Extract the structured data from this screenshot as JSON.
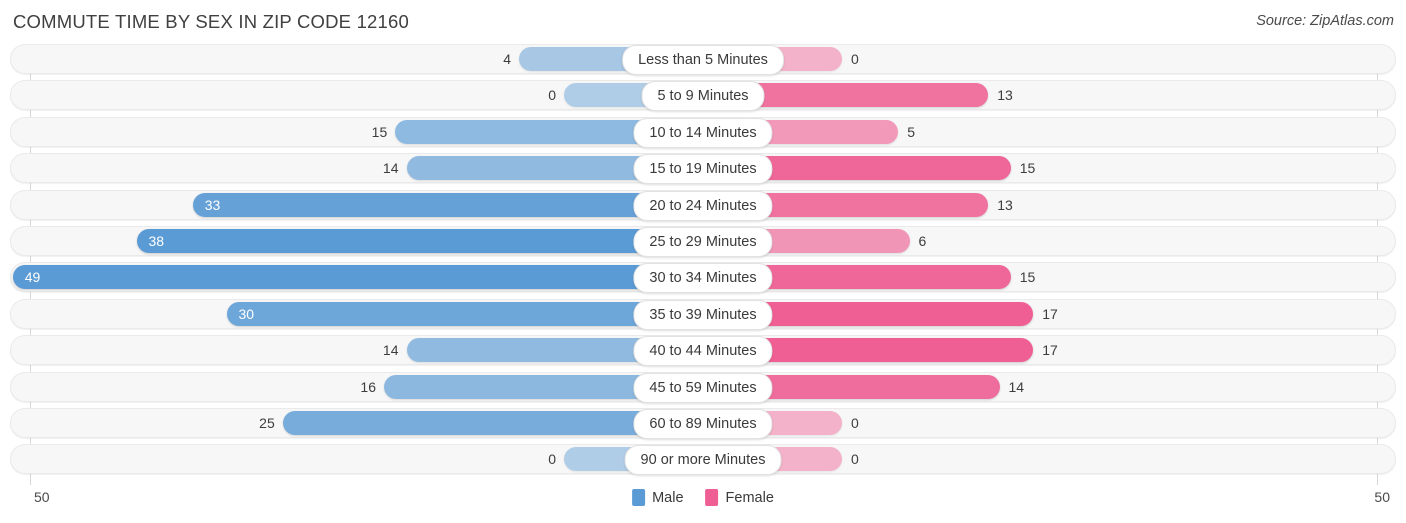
{
  "header": {
    "title": "COMMUTE TIME BY SEX IN ZIP CODE 12160",
    "source": "Source: ZipAtlas.com"
  },
  "axis": {
    "left_max_label": "50",
    "right_max_label": "50"
  },
  "legend": {
    "items": [
      {
        "label": "Male",
        "color": "#5b9bd5"
      },
      {
        "label": "Female",
        "color": "#ef5f93"
      }
    ]
  },
  "colors": {
    "male": "#5b9bd5",
    "female": "#ef5f93",
    "track": "#f7f7f7",
    "gridline": "#d8d8d8"
  },
  "chart_data": {
    "type": "bar",
    "title": "COMMUTE TIME BY SEX IN ZIP CODE 12160",
    "subtitle": "Source: ZipAtlas.com",
    "orientation": "horizontal-diverging",
    "xlabel": "",
    "ylabel": "",
    "xlim": [
      50,
      50
    ],
    "grid": true,
    "legend_position": "bottom-center",
    "categories": [
      "Less than 5 Minutes",
      "5 to 9 Minutes",
      "10 to 14 Minutes",
      "15 to 19 Minutes",
      "20 to 24 Minutes",
      "25 to 29 Minutes",
      "30 to 34 Minutes",
      "35 to 39 Minutes",
      "40 to 44 Minutes",
      "45 to 59 Minutes",
      "60 to 89 Minutes",
      "90 or more Minutes"
    ],
    "series": [
      {
        "name": "Male",
        "color": "#5b9bd5",
        "values": [
          4,
          0,
          15,
          14,
          33,
          38,
          49,
          30,
          14,
          16,
          25,
          0
        ],
        "labels": [
          "4",
          "0",
          "15",
          "14",
          "33",
          "38",
          "49",
          "30",
          "14",
          "16",
          "25",
          "0"
        ]
      },
      {
        "name": "Female",
        "color": "#ef5f93",
        "values": [
          0,
          13,
          5,
          15,
          13,
          6,
          15,
          17,
          17,
          14,
          0,
          0
        ],
        "labels": [
          "0",
          "13",
          "5",
          "15",
          "13",
          "6",
          "15",
          "17",
          "17",
          "14",
          "0",
          "0"
        ]
      }
    ]
  }
}
